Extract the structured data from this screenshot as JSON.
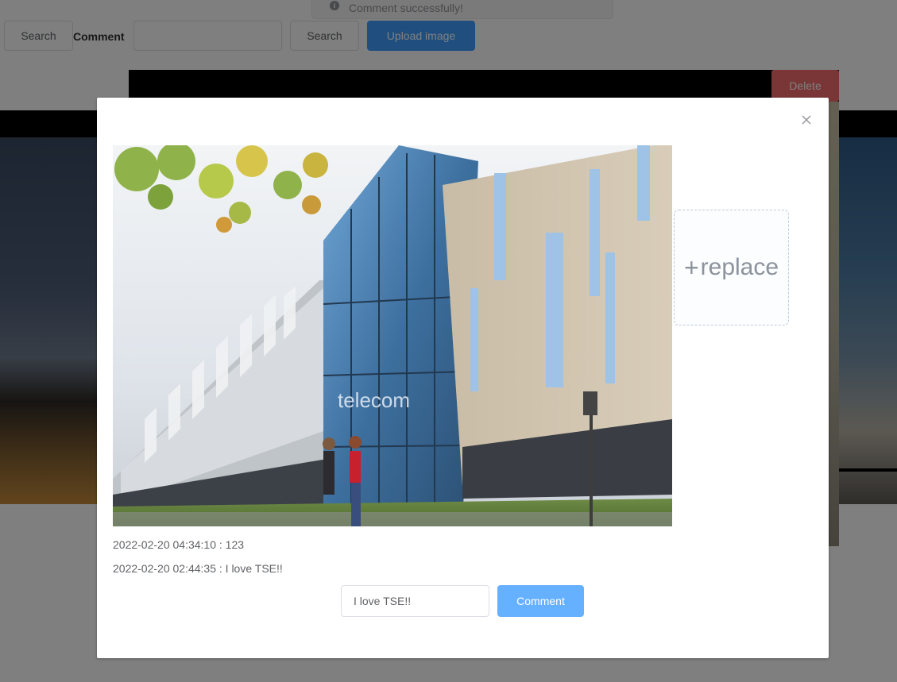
{
  "toast": {
    "message": "Comment successfully!"
  },
  "toolbar": {
    "search_button_1": "Search",
    "comment_label": "Comment",
    "comment_input_value": "",
    "search_button_2": "Search",
    "upload_button": "Upload image"
  },
  "card": {
    "delete_label": "Delete"
  },
  "dialog": {
    "replace_label": "replace",
    "comments": [
      {
        "timestamp": "2022-02-20 04:34:10",
        "text": "123",
        "display": "2022-02-20 04:34:10 : 123"
      },
      {
        "timestamp": "2022-02-20 02:44:35",
        "text": "I love TSE!!",
        "display": "2022-02-20 02:44:35 : I love TSE!!"
      }
    ],
    "comment_input_value": "I love TSE!!",
    "comment_button": "Comment",
    "photo_sign_text": "telecom"
  },
  "colors": {
    "primary": "#409eff",
    "primary_light": "#66b1ff",
    "danger": "#f56c6c",
    "overlay": "rgba(0,0,0,0.5)"
  }
}
